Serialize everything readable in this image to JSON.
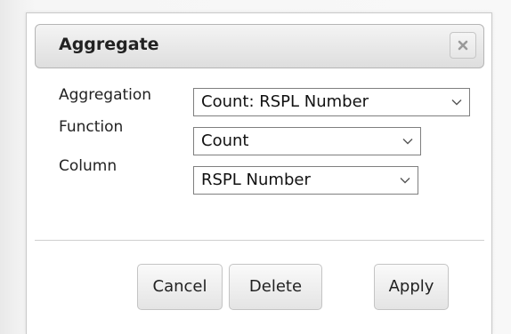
{
  "dialog": {
    "title": "Aggregate",
    "close_icon": "close-x-icon"
  },
  "form": {
    "aggregation": {
      "label": "Aggregation",
      "value": "Count: RSPL Number"
    },
    "function": {
      "label": "Function",
      "value": "Count"
    },
    "column": {
      "label": "Column",
      "value": "RSPL Number"
    }
  },
  "buttons": {
    "cancel": "Cancel",
    "delete": "Delete",
    "apply": "Apply"
  },
  "icons": {
    "dropdown": "chevron-down-icon"
  }
}
